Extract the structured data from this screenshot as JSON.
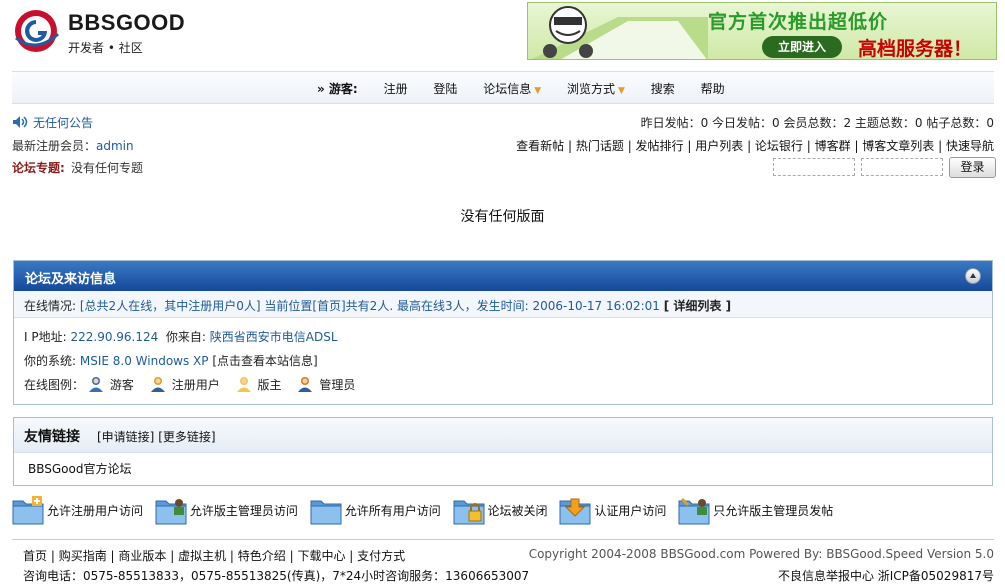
{
  "header": {
    "brand": "BBSGOOD",
    "tagline": "开发者 • 社区",
    "banner": {
      "headline": "官方首次推出超低价",
      "cta": "立即进入",
      "product": "高档服务器！"
    }
  },
  "nav": {
    "prefix": "» 游客:",
    "items": [
      {
        "label": "注册",
        "dropdown": false
      },
      {
        "label": "登陆",
        "dropdown": false
      },
      {
        "label": "论坛信息",
        "dropdown": true
      },
      {
        "label": "浏览方式",
        "dropdown": true
      },
      {
        "label": "搜索",
        "dropdown": false
      },
      {
        "label": "帮助",
        "dropdown": false
      }
    ]
  },
  "info": {
    "announcement": "无任何公告",
    "stats": "昨日发帖：0 今日发帖：0 会员总数：2 主题总数：0 帖子总数：0",
    "new_member_label": "最新注册会员：",
    "new_member": "admin",
    "quick_links": [
      "查看新帖",
      "热门话题",
      "发帖排行",
      "用户列表",
      "论坛银行",
      "博客群",
      "博客文章列表",
      "快速导航"
    ],
    "topic_label": "论坛专题:",
    "topic_text": "没有任何专题",
    "login_button": "登录"
  },
  "no_forum_text": "没有任何版面",
  "online": {
    "title": "论坛及来访信息",
    "status_label": "在线情况:",
    "status_text": "[总共2人在线，其中注册用户0人] 当前位置[首页]共有2人. 最高在线3人，发生时间: 2006-10-17 16:02:01",
    "detail_link": "[ 详细列表 ]",
    "ip_label": "I P地址:",
    "ip": "222.90.96.124",
    "from_label": "你来自:",
    "from": "陕西省西安市电信ADSL",
    "system_label": "你的系统:",
    "system": "MSIE 8.0 Windows XP",
    "system_link": "[点击查看本站信息]",
    "legend_label": "在线图例：",
    "legend": [
      {
        "label": "游客",
        "icon": "guest-user-icon",
        "color": "#3a6fb0"
      },
      {
        "label": "注册用户",
        "icon": "registered-user-icon",
        "color": "#e0a020"
      },
      {
        "label": "版主",
        "icon": "moderator-user-icon",
        "color": "#f2c84b"
      },
      {
        "label": "管理员",
        "icon": "admin-user-icon",
        "color": "#d47b1e"
      }
    ]
  },
  "links": {
    "title": "友情链接",
    "apply": "[申请链接]",
    "more": "[更多链接]",
    "items": [
      "BBSGood官方论坛"
    ]
  },
  "folder_legend": [
    {
      "label": "允许注册用户访问",
      "icon": "folder-plus-icon"
    },
    {
      "label": "允许版主管理员访问",
      "icon": "folder-user-icon"
    },
    {
      "label": "允许所有用户访问",
      "icon": "folder-icon"
    },
    {
      "label": "论坛被关闭",
      "icon": "folder-lock-icon"
    },
    {
      "label": "认证用户访问",
      "icon": "folder-download-icon"
    },
    {
      "label": "只允许版主管理员发帖",
      "icon": "folder-edit-icon"
    }
  ],
  "footer": {
    "links": [
      "首页",
      "购买指南",
      "商业版本",
      "虚拟主机",
      "特色介绍",
      "下载中心",
      "支付方式"
    ],
    "copyright": "Copyright 2004-2008 BBSGood.com Powered By: BBSGood.Speed Version 5.0",
    "contact": "咨询电话：0575-85513833，0575-85513825(传真)，7*24小时咨询服务：13606653007",
    "report": "不良信息举报中心  浙ICP备05029817号"
  },
  "colors": {
    "header_bar": "#14489a",
    "link_blue": "#1e5b9a",
    "topic_red": "#8b1b1b",
    "caret_orange": "#e89a2c"
  }
}
